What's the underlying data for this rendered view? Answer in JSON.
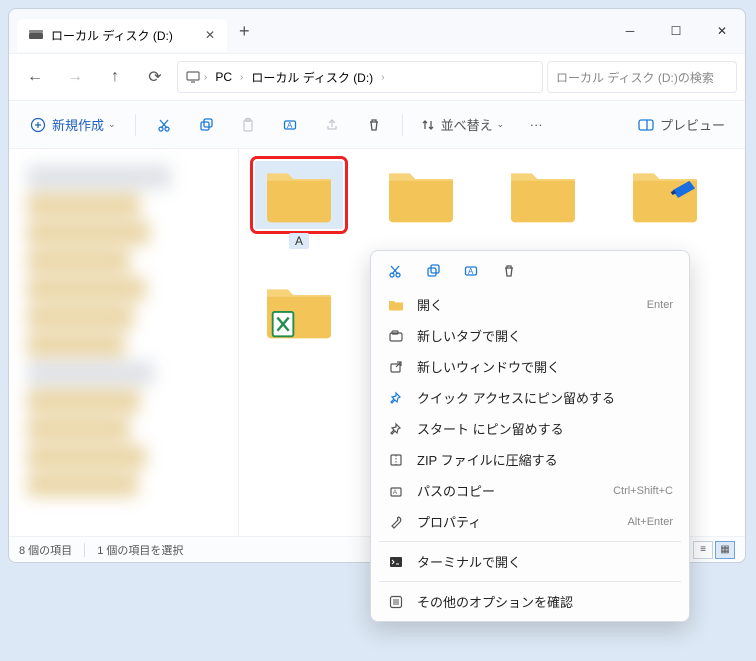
{
  "titlebar": {
    "tab_title": "ローカル ディスク (D:)"
  },
  "breadcrumb": {
    "pc": "PC",
    "drive": "ローカル ディスク (D:)"
  },
  "search": {
    "placeholder": "ローカル ディスク (D:)の検索"
  },
  "toolbar": {
    "new": "新規作成",
    "sort": "並べ替え",
    "more": "···",
    "preview": "プレビュー"
  },
  "folders": [
    {
      "name": "A",
      "selected": true,
      "variant": "plain"
    },
    {
      "name": "",
      "variant": "plain"
    },
    {
      "name": "",
      "variant": "plain"
    },
    {
      "name": "",
      "variant": "pen"
    },
    {
      "name": "",
      "variant": "xls"
    }
  ],
  "status": {
    "count": "8 個の項目",
    "selected": "1 個の項目を選択"
  },
  "ctx": {
    "open": "開く",
    "open_accel": "Enter",
    "new_tab": "新しいタブで開く",
    "new_window": "新しいウィンドウで開く",
    "pin_quick": "クイック アクセスにピン留めする",
    "pin_start": "スタート にピン留めする",
    "zip": "ZIP ファイルに圧縮する",
    "copy_path": "パスのコピー",
    "copy_path_accel": "Ctrl+Shift+C",
    "properties": "プロパティ",
    "properties_accel": "Alt+Enter",
    "terminal": "ターミナルで開く",
    "more": "その他のオプションを確認"
  }
}
